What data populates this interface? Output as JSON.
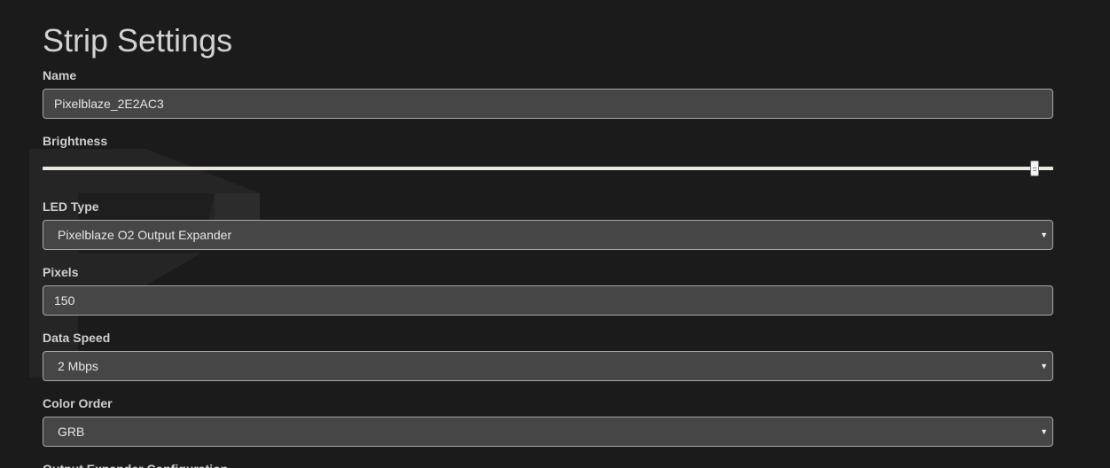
{
  "page": {
    "title": "Strip Settings"
  },
  "fields": {
    "name": {
      "label": "Name",
      "value": "Pixelblaze_2E2AC3"
    },
    "brightness": {
      "label": "Brightness",
      "level_fraction": 0.982
    },
    "led_type": {
      "label": "LED Type",
      "selected": "Pixelblaze O2 Output Expander"
    },
    "pixels": {
      "label": "Pixels",
      "value": "150"
    },
    "data_speed": {
      "label": "Data Speed",
      "selected": "2 Mbps"
    },
    "color_order": {
      "label": "Color Order",
      "selected": "GRB"
    },
    "output_expander": {
      "label": "Output Expander Configuration"
    }
  },
  "icons": {
    "select_caret": "chevron-down-icon",
    "watermark": "pixelblaze-logo-watermark"
  },
  "colors": {
    "background": "#1b1b1b",
    "field_bg": "#464646",
    "field_border": "#a8a8a8",
    "text": "#cccccc",
    "slider_track": "#ece7de"
  }
}
